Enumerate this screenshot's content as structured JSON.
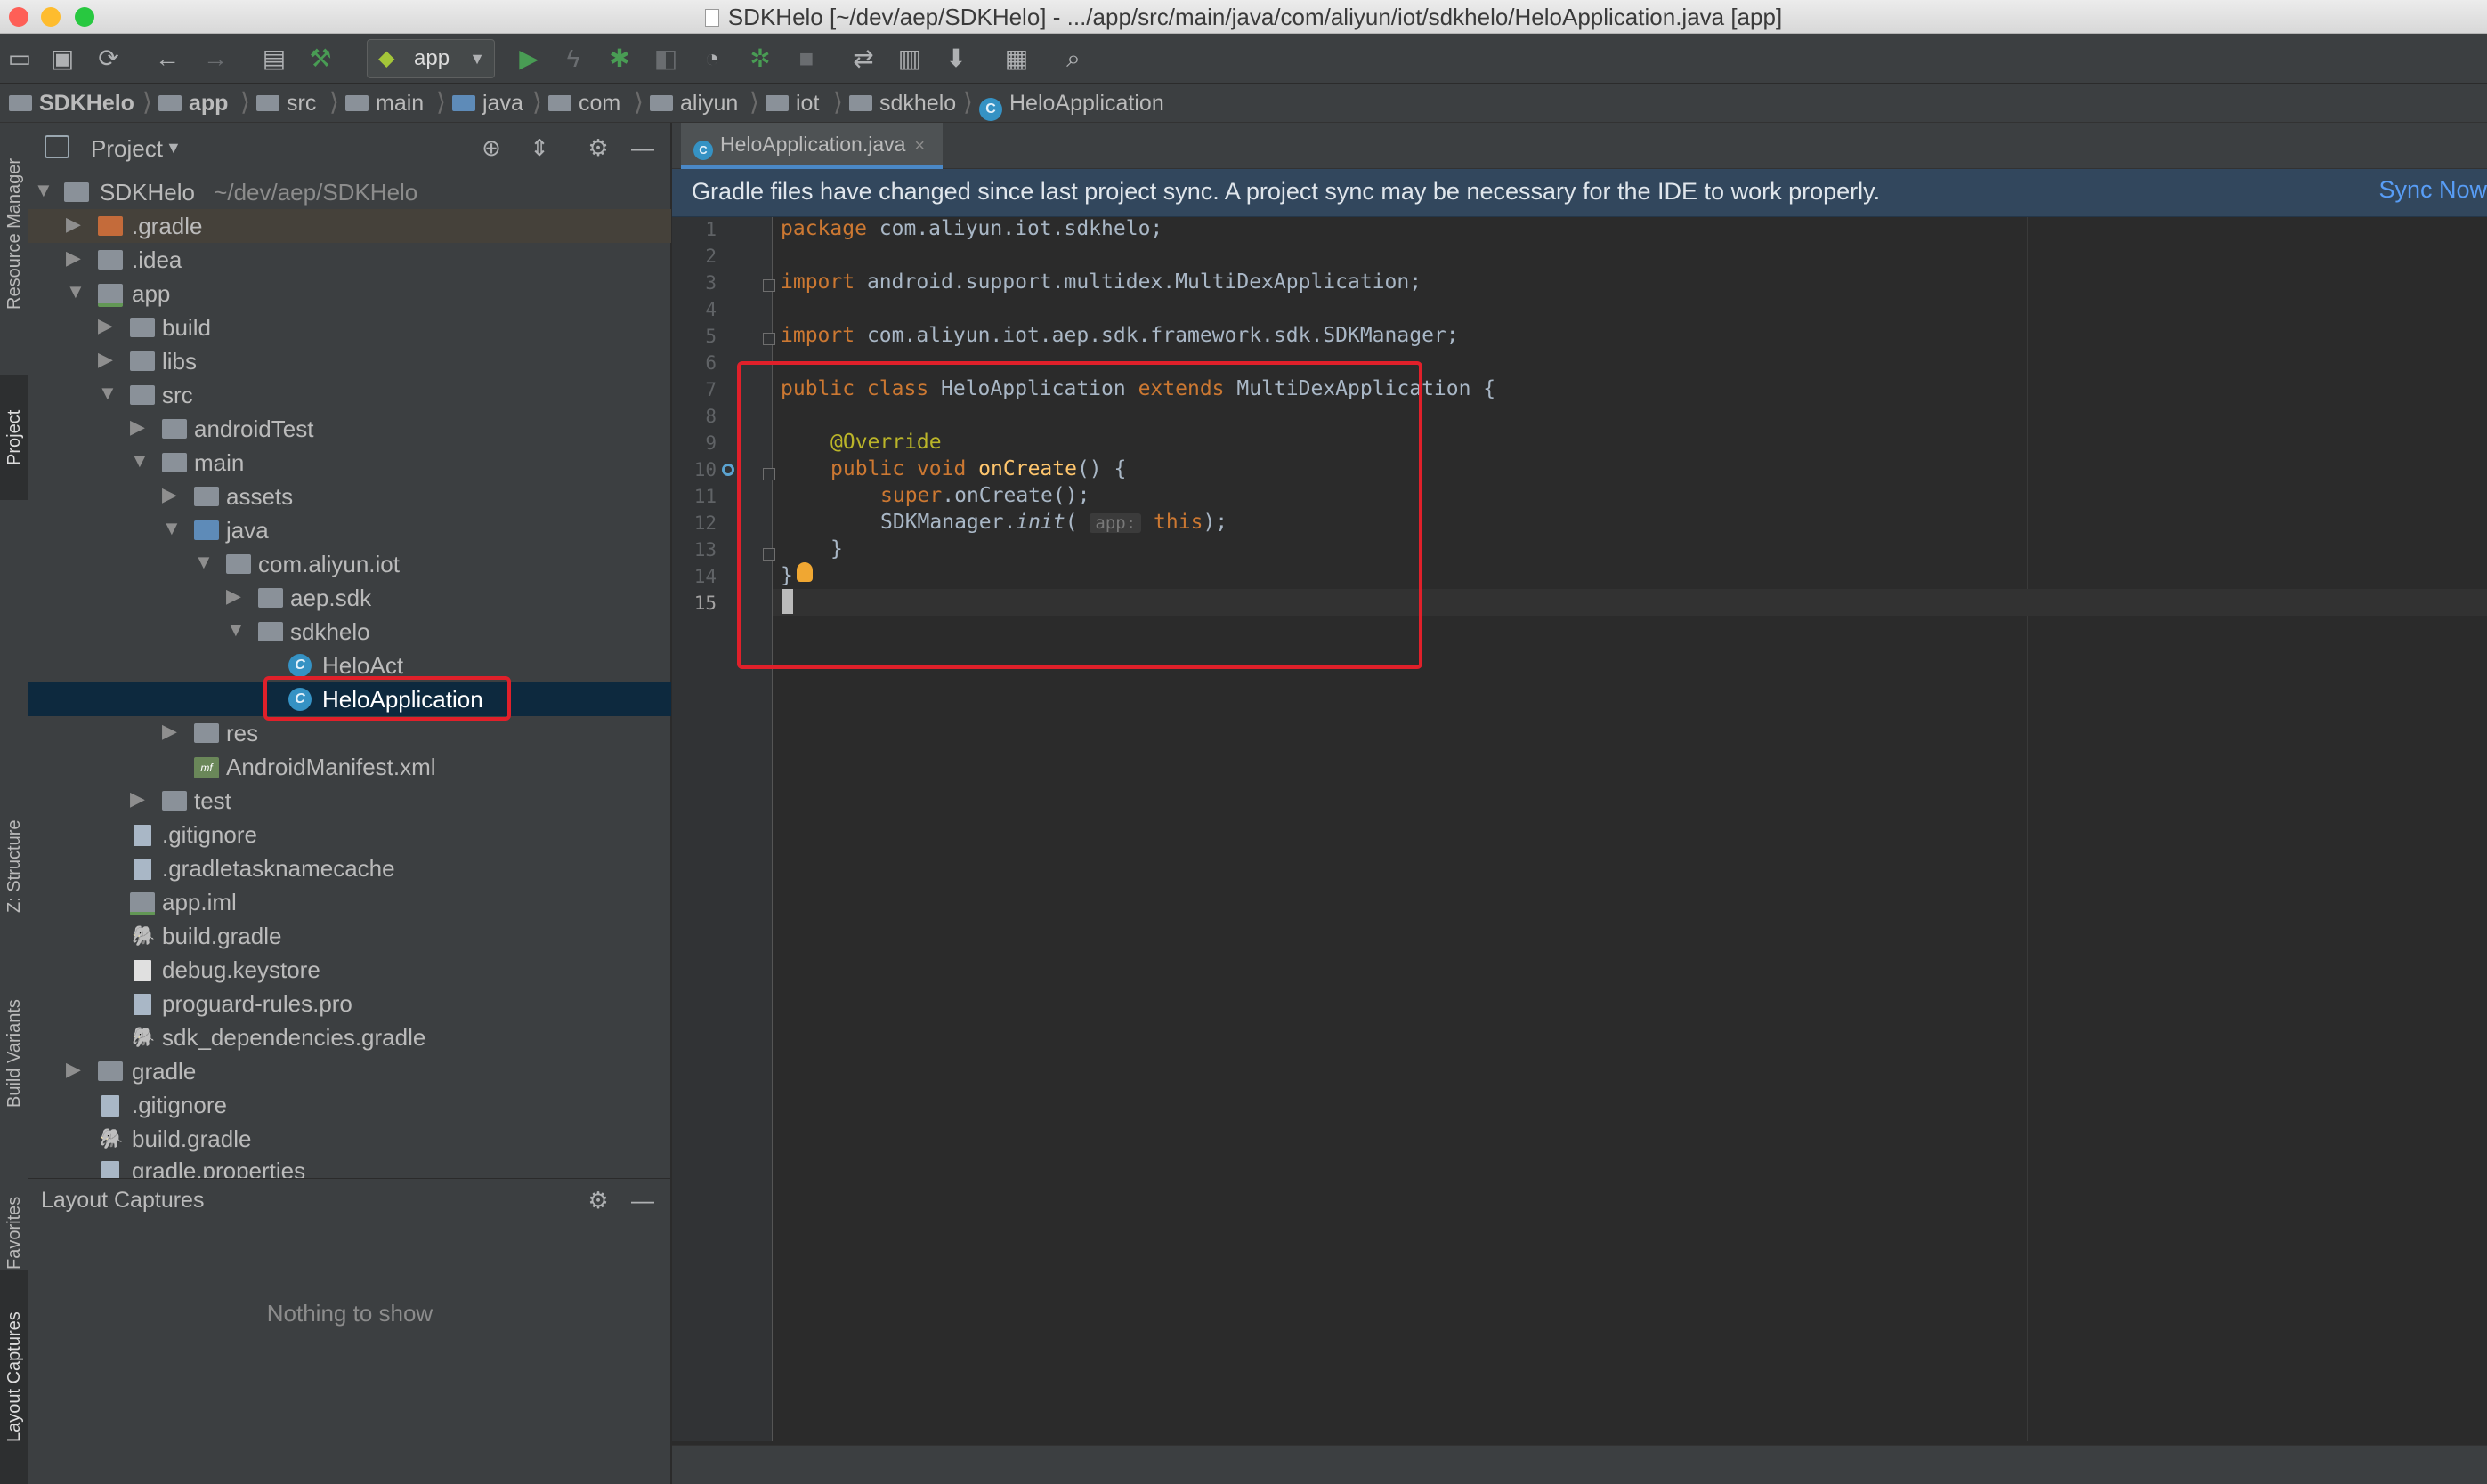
{
  "window": {
    "title": "SDKHelo [~/dev/aep/SDKHelo] - .../app/src/main/java/com/aliyun/iot/sdkhelo/HeloApplication.java [app]"
  },
  "toolbar": {
    "run_config": "app"
  },
  "breadcrumb": [
    "SDKHelo",
    "app",
    "src",
    "main",
    "java",
    "com",
    "aliyun",
    "iot",
    "sdkhelo",
    "HeloApplication"
  ],
  "left_strip": {
    "tabs": [
      "Resource Manager",
      "Project",
      "Z: Structure",
      "Build Variants",
      "Favorites",
      "Layout Captures"
    ]
  },
  "project_panel": {
    "title": "Project",
    "tree": [
      {
        "label": "SDKHelo",
        "extra": "~/dev/aep/SDKHelo",
        "expanded": true
      },
      {
        "label": ".gradle",
        "expanded": false
      },
      {
        "label": ".idea",
        "expanded": false
      },
      {
        "label": "app",
        "expanded": true
      },
      {
        "label": "build",
        "expanded": false
      },
      {
        "label": "libs",
        "expanded": false
      },
      {
        "label": "src",
        "expanded": true
      },
      {
        "label": "androidTest",
        "expanded": false
      },
      {
        "label": "main",
        "expanded": true
      },
      {
        "label": "assets",
        "expanded": false
      },
      {
        "label": "java",
        "expanded": true
      },
      {
        "label": "com.aliyun.iot",
        "expanded": true
      },
      {
        "label": "aep.sdk",
        "expanded": false
      },
      {
        "label": "sdkhelo",
        "expanded": true
      },
      {
        "label": "HeloAct"
      },
      {
        "label": "HeloApplication",
        "selected": true
      },
      {
        "label": "res",
        "expanded": false
      },
      {
        "label": "AndroidManifest.xml"
      },
      {
        "label": "test",
        "expanded": false
      },
      {
        "label": ".gitignore"
      },
      {
        "label": ".gradletasknamecache"
      },
      {
        "label": "app.iml"
      },
      {
        "label": "build.gradle"
      },
      {
        "label": "debug.keystore"
      },
      {
        "label": "proguard-rules.pro"
      },
      {
        "label": "sdk_dependencies.gradle"
      },
      {
        "label": "gradle",
        "expanded": false
      },
      {
        "label": ".gitignore"
      },
      {
        "label": "build.gradle"
      },
      {
        "label": "gradle.properties"
      }
    ]
  },
  "captures_panel": {
    "title": "Layout Captures",
    "empty_text": "Nothing to show"
  },
  "editor": {
    "tab_label": "HeloApplication.java",
    "notification": "Gradle files have changed since last project sync. A project sync may be necessary for the IDE to work properly.",
    "notification_action": "Sync Now",
    "line_numbers": [
      "1",
      "2",
      "3",
      "4",
      "5",
      "6",
      "7",
      "8",
      "9",
      "10",
      "11",
      "12",
      "13",
      "14",
      "15"
    ],
    "code": {
      "l1_kw": "package",
      "l1_rest": " com.aliyun.iot.sdkhelo;",
      "l3_kw": "import",
      "l3_rest": " android.support.multidex.MultiDexApplication;",
      "l5_kw": "import",
      "l5_rest": " com.aliyun.iot.aep.sdk.framework.sdk.SDKManager;",
      "l7_kw1": "public class",
      "l7_name": " HeloApplication ",
      "l7_kw2": "extends",
      "l7_rest": " MultiDexApplication {",
      "l9_annotation": "@Override",
      "l10_kw": "public void",
      "l10_fn": " onCreate",
      "l10_rest": "() {",
      "l11_kw": "super",
      "l11_rest": ".onCreate();",
      "l12_a": "SDKManager.",
      "l12_fn": "init",
      "l12_b": "( ",
      "l12_hint": "app:",
      "l12_kw": " this",
      "l12_c": ");",
      "l13": "}",
      "l14": "}"
    }
  },
  "colors": {
    "highlight": "#e0202a",
    "accent": "#4a88c7",
    "selection": "#0d293e"
  }
}
